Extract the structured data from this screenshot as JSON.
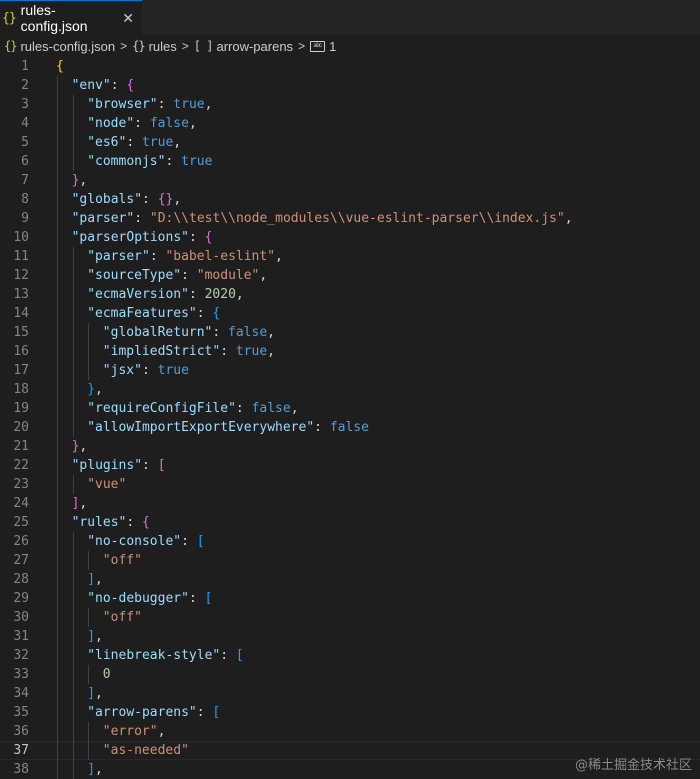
{
  "tab": {
    "icon": "{}",
    "title": "rules-config.json",
    "close": "✕"
  },
  "breadcrumb": [
    {
      "icon": "{}",
      "label": "rules-config.json",
      "icon_color": "#cbcb41"
    },
    {
      "icon": "{}",
      "label": "rules",
      "icon_color": "#cccccc"
    },
    {
      "icon": "[ ]",
      "label": "arrow-parens",
      "icon_color": "#cccccc"
    },
    {
      "icon": "abc",
      "label": "1",
      "icon_color": "#cccccc"
    }
  ],
  "editor": {
    "current_line": 37,
    "lines": [
      {
        "n": "1",
        "tokens": [
          [
            "{",
            "br1"
          ]
        ]
      },
      {
        "n": "2",
        "tokens": [
          [
            "\"env\"",
            "k"
          ],
          [
            ": ",
            "p"
          ],
          [
            "{",
            "br2"
          ]
        ]
      },
      {
        "n": "3",
        "tokens": [
          [
            "\"browser\"",
            "k"
          ],
          [
            ": ",
            "p"
          ],
          [
            "true",
            "b"
          ],
          [
            ",",
            "p"
          ]
        ]
      },
      {
        "n": "4",
        "tokens": [
          [
            "\"node\"",
            "k"
          ],
          [
            ": ",
            "p"
          ],
          [
            "false",
            "b"
          ],
          [
            ",",
            "p"
          ]
        ]
      },
      {
        "n": "5",
        "tokens": [
          [
            "\"es6\"",
            "k"
          ],
          [
            ": ",
            "p"
          ],
          [
            "true",
            "b"
          ],
          [
            ",",
            "p"
          ]
        ]
      },
      {
        "n": "6",
        "tokens": [
          [
            "\"commonjs\"",
            "k"
          ],
          [
            ": ",
            "p"
          ],
          [
            "true",
            "b"
          ]
        ]
      },
      {
        "n": "7",
        "tokens": [
          [
            "}",
            "br2"
          ],
          [
            ",",
            "p"
          ]
        ]
      },
      {
        "n": "8",
        "tokens": [
          [
            "\"globals\"",
            "k"
          ],
          [
            ": ",
            "p"
          ],
          [
            "{}",
            "br2"
          ],
          [
            ",",
            "p"
          ]
        ]
      },
      {
        "n": "9",
        "tokens": [
          [
            "\"parser\"",
            "k"
          ],
          [
            ": ",
            "p"
          ],
          [
            "\"D:",
            "s"
          ],
          [
            "\\\\",
            "s"
          ],
          [
            "test",
            "s"
          ],
          [
            "\\\\",
            "s"
          ],
          [
            "node_modules",
            "s"
          ],
          [
            "\\\\",
            "s"
          ],
          [
            "vue-eslint-parser",
            "s"
          ],
          [
            "\\\\",
            "s"
          ],
          [
            "index.js\"",
            "s"
          ],
          [
            ",",
            "p"
          ]
        ]
      },
      {
        "n": "10",
        "tokens": [
          [
            "\"parserOptions\"",
            "k"
          ],
          [
            ": ",
            "p"
          ],
          [
            "{",
            "br2"
          ]
        ]
      },
      {
        "n": "11",
        "tokens": [
          [
            "\"parser\"",
            "k"
          ],
          [
            ": ",
            "p"
          ],
          [
            "\"babel-eslint\"",
            "s"
          ],
          [
            ",",
            "p"
          ]
        ]
      },
      {
        "n": "12",
        "tokens": [
          [
            "\"sourceType\"",
            "k"
          ],
          [
            ": ",
            "p"
          ],
          [
            "\"module\"",
            "s"
          ],
          [
            ",",
            "p"
          ]
        ]
      },
      {
        "n": "13",
        "tokens": [
          [
            "\"ecmaVersion\"",
            "k"
          ],
          [
            ": ",
            "p"
          ],
          [
            "2020",
            "n"
          ],
          [
            ",",
            "p"
          ]
        ]
      },
      {
        "n": "14",
        "tokens": [
          [
            "\"ecmaFeatures\"",
            "k"
          ],
          [
            ": ",
            "p"
          ],
          [
            "{",
            "br3"
          ]
        ]
      },
      {
        "n": "15",
        "tokens": [
          [
            "\"globalReturn\"",
            "k"
          ],
          [
            ": ",
            "p"
          ],
          [
            "false",
            "b"
          ],
          [
            ",",
            "p"
          ]
        ]
      },
      {
        "n": "16",
        "tokens": [
          [
            "\"impliedStrict\"",
            "k"
          ],
          [
            ": ",
            "p"
          ],
          [
            "true",
            "b"
          ],
          [
            ",",
            "p"
          ]
        ]
      },
      {
        "n": "17",
        "tokens": [
          [
            "\"jsx\"",
            "k"
          ],
          [
            ": ",
            "p"
          ],
          [
            "true",
            "b"
          ]
        ]
      },
      {
        "n": "18",
        "tokens": [
          [
            "}",
            "br3"
          ],
          [
            ",",
            "p"
          ]
        ]
      },
      {
        "n": "19",
        "tokens": [
          [
            "\"requireConfigFile\"",
            "k"
          ],
          [
            ": ",
            "p"
          ],
          [
            "false",
            "b"
          ],
          [
            ",",
            "p"
          ]
        ]
      },
      {
        "n": "20",
        "tokens": [
          [
            "\"allowImportExportEverywhere\"",
            "k"
          ],
          [
            ": ",
            "p"
          ],
          [
            "false",
            "b"
          ]
        ]
      },
      {
        "n": "21",
        "tokens": [
          [
            "}",
            "br2"
          ],
          [
            ",",
            "p"
          ]
        ]
      },
      {
        "n": "22",
        "tokens": [
          [
            "\"plugins\"",
            "k"
          ],
          [
            ": ",
            "p"
          ],
          [
            "[",
            "br2"
          ]
        ]
      },
      {
        "n": "23",
        "tokens": [
          [
            "\"vue\"",
            "s"
          ]
        ]
      },
      {
        "n": "24",
        "tokens": [
          [
            "]",
            "br2"
          ],
          [
            ",",
            "p"
          ]
        ]
      },
      {
        "n": "25",
        "tokens": [
          [
            "\"rules\"",
            "k"
          ],
          [
            ": ",
            "p"
          ],
          [
            "{",
            "br2"
          ]
        ]
      },
      {
        "n": "26",
        "tokens": [
          [
            "\"no-console\"",
            "k"
          ],
          [
            ": ",
            "p"
          ],
          [
            "[",
            "br3"
          ]
        ]
      },
      {
        "n": "27",
        "tokens": [
          [
            "\"off\"",
            "s"
          ]
        ]
      },
      {
        "n": "28",
        "tokens": [
          [
            "]",
            "br3"
          ],
          [
            ",",
            "p"
          ]
        ]
      },
      {
        "n": "29",
        "tokens": [
          [
            "\"no-debugger\"",
            "k"
          ],
          [
            ": ",
            "p"
          ],
          [
            "[",
            "br3"
          ]
        ]
      },
      {
        "n": "30",
        "tokens": [
          [
            "\"off\"",
            "s"
          ]
        ]
      },
      {
        "n": "31",
        "tokens": [
          [
            "]",
            "br3"
          ],
          [
            ",",
            "p"
          ]
        ]
      },
      {
        "n": "32",
        "tokens": [
          [
            "\"linebreak-style\"",
            "k"
          ],
          [
            ": ",
            "p"
          ],
          [
            "[",
            "br3"
          ]
        ]
      },
      {
        "n": "33",
        "tokens": [
          [
            "0",
            "n"
          ]
        ]
      },
      {
        "n": "34",
        "tokens": [
          [
            "]",
            "br3"
          ],
          [
            ",",
            "p"
          ]
        ]
      },
      {
        "n": "35",
        "tokens": [
          [
            "\"arrow-parens\"",
            "k"
          ],
          [
            ": ",
            "p"
          ],
          [
            "[",
            "br3"
          ]
        ]
      },
      {
        "n": "36",
        "tokens": [
          [
            "\"error\"",
            "s"
          ],
          [
            ",",
            "p"
          ]
        ]
      },
      {
        "n": "37",
        "tokens": [
          [
            "\"as-needed\"",
            "s"
          ]
        ]
      },
      {
        "n": "38",
        "tokens": [
          [
            "]",
            "br3"
          ],
          [
            ",",
            "p"
          ]
        ]
      }
    ]
  },
  "watermark": "@稀土掘金技术社区",
  "colors": {
    "background": "#1e1e1e",
    "key": "#9cdcfe",
    "string": "#ce9178",
    "boolean": "#569cd6",
    "number": "#b5cea8",
    "bracket_level1": "#ffd700",
    "bracket_level2": "#da70d6",
    "bracket_level3": "#179fff"
  }
}
